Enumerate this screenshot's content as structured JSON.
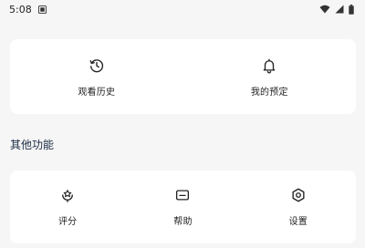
{
  "status_bar": {
    "time": "5:08",
    "icons": [
      "notification-icon",
      "wifi-icon",
      "signal-icon",
      "battery-icon"
    ]
  },
  "top_card": {
    "items": [
      {
        "label": "观看历史",
        "icon": "history-icon"
      },
      {
        "label": "我的预定",
        "icon": "bell-icon"
      }
    ]
  },
  "other": {
    "title": "其他功能",
    "items": [
      {
        "label": "评分",
        "icon": "rating-icon"
      },
      {
        "label": "帮助",
        "icon": "help-icon"
      },
      {
        "label": "设置",
        "icon": "settings-icon"
      }
    ]
  },
  "colors": {
    "background": "#f6f6f6",
    "card": "#ffffff",
    "section_title": "#1c2b44"
  }
}
